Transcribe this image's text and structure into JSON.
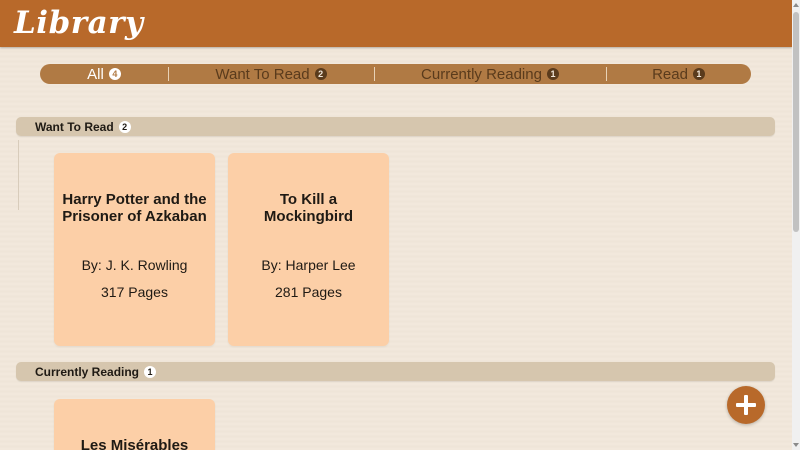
{
  "header": {
    "title": "Library"
  },
  "tabs": [
    {
      "label": "All",
      "count": "4"
    },
    {
      "label": "Want To Read",
      "count": "2"
    },
    {
      "label": "Currently Reading",
      "count": "1"
    },
    {
      "label": "Read",
      "count": "1"
    }
  ],
  "sections": [
    {
      "title": "Want To Read",
      "count": "2",
      "books": [
        {
          "title": "Harry Potter and the Prisoner of Azkaban",
          "author": "By: J. K. Rowling",
          "pages": "317 Pages"
        },
        {
          "title": "To Kill a Mockingbird",
          "author": "By: Harper Lee",
          "pages": "281 Pages"
        }
      ]
    },
    {
      "title": "Currently Reading",
      "count": "1",
      "books": [
        {
          "title": "Les Misérables"
        }
      ]
    }
  ],
  "fab": {
    "icon": "plus-icon"
  },
  "colors": {
    "header": "#b8692a",
    "tabbar": "#b07a44",
    "card": "#fccfa7",
    "section_bar": "#d6c6ae",
    "background": "#f1e7da"
  }
}
